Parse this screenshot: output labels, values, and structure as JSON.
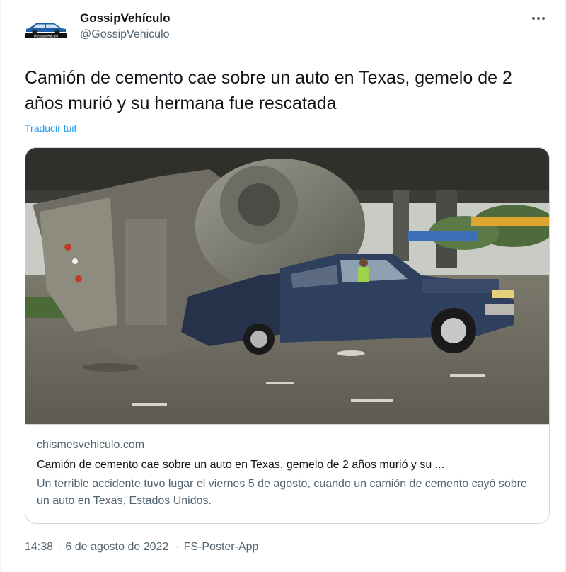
{
  "author": {
    "name": "GossipVehículo",
    "handle": "@GossipVehiculo",
    "avatar_label": "GossipVehiculo"
  },
  "tweet": {
    "text": "Camión de cemento cae sobre un auto en Texas, gemelo de 2 años murió y su hermana fue rescatada",
    "translate_label": "Traducir tuit"
  },
  "card": {
    "domain": "chismesvehiculo.com",
    "title": "Camión de cemento cae sobre un auto en Texas, gemelo de 2 años murió y su ...",
    "description": "Un terrible accidente tuvo lugar el viernes 5 de agosto, cuando un camión de cemento cayó sobre un auto en Texas, Estados Unidos."
  },
  "meta": {
    "time": "14:38",
    "date": "6 de agosto de 2022",
    "separator": "·",
    "source": "FS-Poster-App"
  },
  "icons": {
    "more": "more-horizontal-icon",
    "avatar_logo": "car-logo-icon"
  },
  "colors": {
    "accent": "#1d9bf0",
    "secondary_text": "#536471",
    "border": "#cfd9de"
  }
}
